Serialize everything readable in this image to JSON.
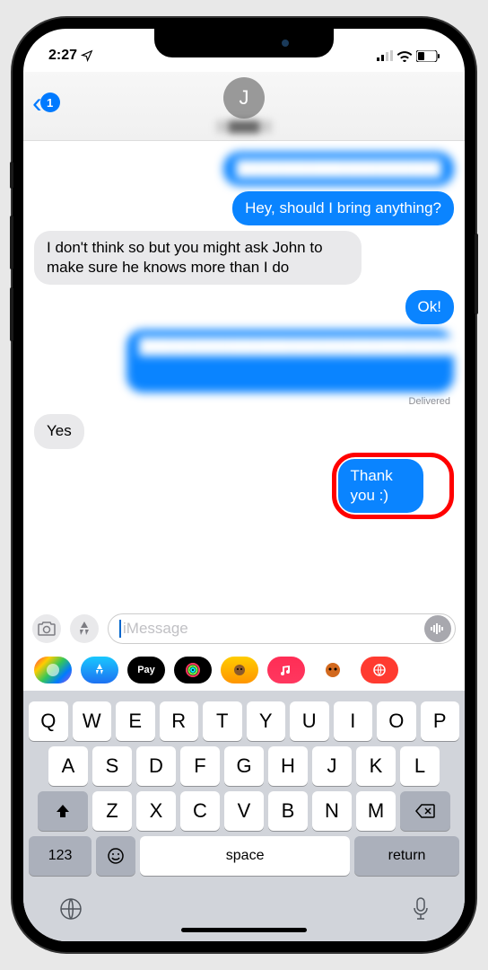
{
  "status": {
    "time": "2:27",
    "location_arrow": "➤"
  },
  "nav": {
    "back_count": "1",
    "avatar_initial": "J",
    "contact_name": "████"
  },
  "messages": [
    {
      "side": "sent",
      "text": "███████████████████",
      "blurred": true
    },
    {
      "side": "sent",
      "text": "Hey, should I bring anything?",
      "blurred": false
    },
    {
      "side": "received",
      "text": "I don't think so but you might ask John to make sure he knows more than I do",
      "blurred": false
    },
    {
      "side": "sent",
      "text": "Ok!",
      "blurred": false
    },
    {
      "side": "sent",
      "text": "████████████████████████████████",
      "blurred": true,
      "wide": true
    },
    {
      "side": "received",
      "text": "Yes",
      "blurred": false
    },
    {
      "side": "sent",
      "text": "Thank you :)",
      "blurred": false,
      "highlighted": true
    }
  ],
  "delivered_label": "Delivered",
  "input": {
    "placeholder": "iMessage"
  },
  "keyboard": {
    "row1": [
      "Q",
      "W",
      "E",
      "R",
      "T",
      "Y",
      "U",
      "I",
      "O",
      "P"
    ],
    "row2": [
      "A",
      "S",
      "D",
      "F",
      "G",
      "H",
      "J",
      "K",
      "L"
    ],
    "row3": [
      "Z",
      "X",
      "C",
      "V",
      "B",
      "N",
      "M"
    ],
    "num_label": "123",
    "space_label": "space",
    "return_label": "return"
  }
}
